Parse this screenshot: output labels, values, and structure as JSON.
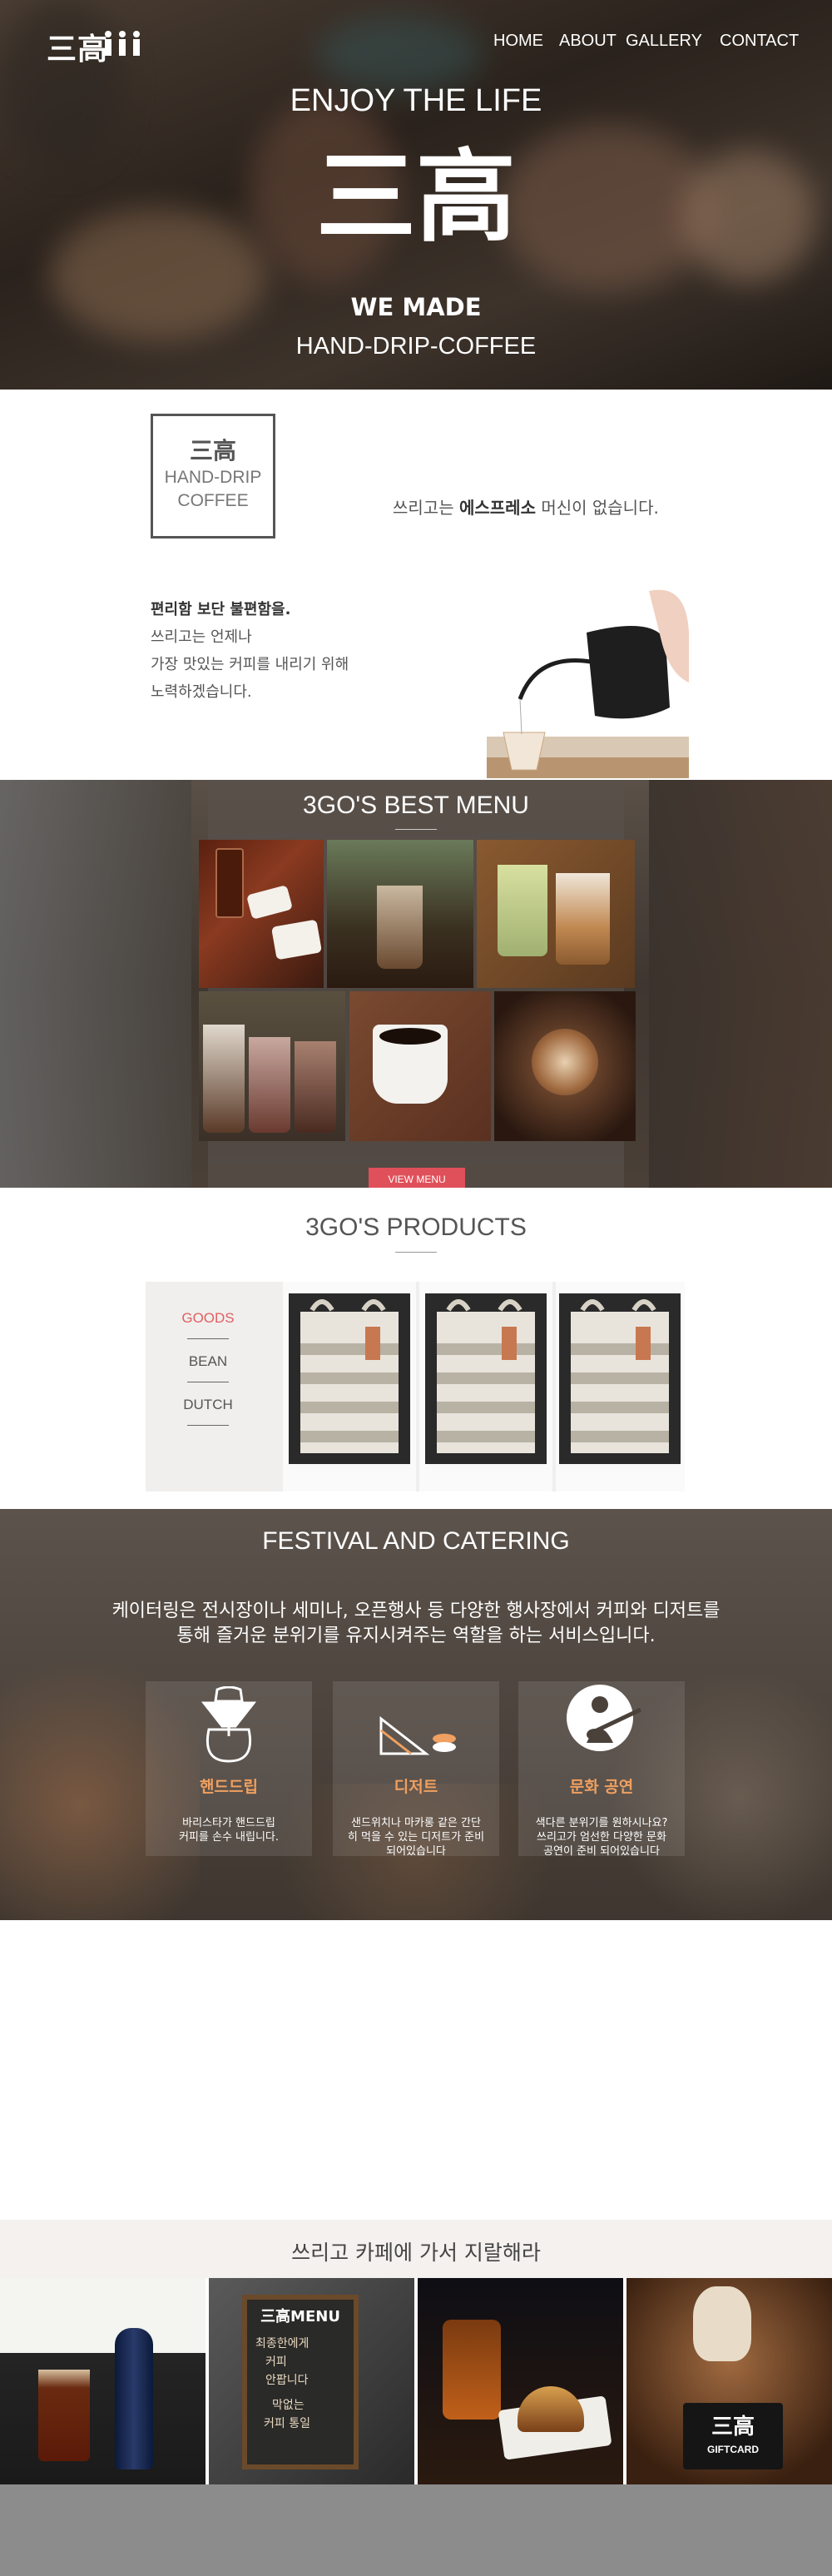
{
  "brand": {
    "logo_text": "三高"
  },
  "nav": {
    "items": [
      "HOME",
      "ABOUT",
      "GALLERY",
      "CONTACT"
    ]
  },
  "hero": {
    "tagline": "ENJOY THE LIFE",
    "big_logo": "三高",
    "made": "WE MADE",
    "product": "HAND-DRIP-COFFEE"
  },
  "intro": {
    "box_logo": "三高",
    "box_line1": "HAND-DRIP",
    "box_line2": "COFFEE",
    "no_espresso_pre": "쓰리고는 ",
    "no_espresso_bold": "에스프레소",
    "no_espresso_post": " 머신이 없습니다.",
    "lines": [
      "편리함 보단 불편함을.",
      "쓰리고는 언제나",
      "가장 맛있는 커피를 내리기 위해",
      "노력하겠습니다."
    ]
  },
  "menu": {
    "title": "3GO'S BEST MENU",
    "button": "VIEW MENU"
  },
  "products": {
    "title": "3GO'S PRODUCTS",
    "tabs": [
      "GOODS",
      "BEAN",
      "DUTCH"
    ],
    "active_tab": "GOODS"
  },
  "festival": {
    "title": "FESTIVAL AND CATERING",
    "desc_line1": "케이터링은 전시장이나 세미나, 오픈행사 등 다양한 행사장에서 커피와 디저트를",
    "desc_line2": "통해 즐거운 분위기를 유지시켜주는 역할을 하는 서비스입니다.",
    "cards": [
      {
        "icon": "drip-coffee-icon",
        "title": "핸드드립",
        "desc": [
          "바리스타가 핸드드립",
          "커피를 손수 내립니다."
        ]
      },
      {
        "icon": "dessert-icon",
        "title": "디저트",
        "desc": [
          "샌드위치나 마카롱 같은 간단",
          "히 먹을 수 있는 디저트가 준비",
          "되어있습니다"
        ]
      },
      {
        "icon": "guitar-player-icon",
        "title": "문화 공연",
        "desc": [
          "색다른 분위기를 원하시나요?",
          "쓰리고가 엄선한 다양한 문화",
          "공연이 준비 되어있습니다"
        ]
      }
    ]
  },
  "gallery": {
    "title": "쓰리고 카페에 가서 지랄해라",
    "board_title": "三高MENU",
    "board_lines": [
      "최종한에게",
      "커피",
      "안팝니다",
      "막없는",
      "커피 통일"
    ],
    "giftcard_logo": "三高",
    "giftcard_label": "GIFTCARD"
  },
  "colors": {
    "accent": "#e0505a",
    "orange": "#f0a060",
    "tab_active": "#e06060"
  }
}
